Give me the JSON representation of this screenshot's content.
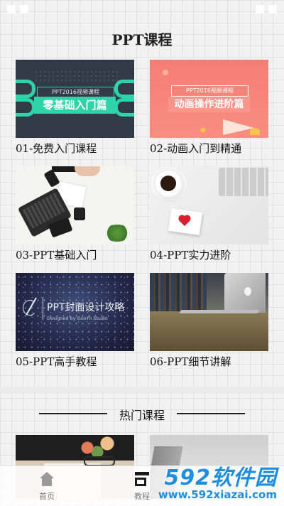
{
  "page": {
    "title": "PPT课程"
  },
  "courses": [
    {
      "caption": "01-免费入门课程",
      "thumb_tag": "PPT2016视频课程",
      "thumb_title": "零基础入门篇"
    },
    {
      "caption": "02-动画入门到精通",
      "thumb_tag": "PPT2016视频课程",
      "thumb_title": "动画操作进阶篇"
    },
    {
      "caption": "03-PPT基础入门"
    },
    {
      "caption": "04-PPT实力进阶"
    },
    {
      "caption": "05-PPT高手教程",
      "thumb_title": "PPT封面设计攻略",
      "thumb_subtitle": "Designed by GooYii Studio"
    },
    {
      "caption": "06-PPT细节讲解"
    }
  ],
  "hot_section": {
    "title": "热门课程"
  },
  "tab_bar": {
    "tabs": [
      {
        "label": "首页",
        "icon": "home-icon"
      },
      {
        "label": "教程",
        "icon": "course-icon"
      }
    ]
  },
  "watermark": {
    "logo": "592软件园",
    "url": "www.592xiazai.com"
  },
  "colors": {
    "accent_green": "#2fd3a8",
    "card2_coral": "#f57e74",
    "watermark_blue": "#1f8ee0"
  }
}
